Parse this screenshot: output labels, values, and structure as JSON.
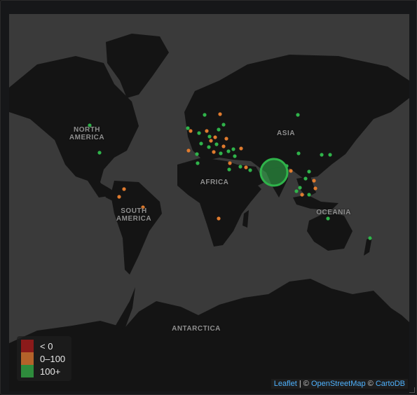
{
  "map": {
    "continent_labels": [
      {
        "id": "north-america",
        "text": "NORTH\nAMERICA"
      },
      {
        "id": "asia",
        "text": "ASIA"
      },
      {
        "id": "africa",
        "text": "AFRICA"
      },
      {
        "id": "south-america",
        "text": "SOUTH\nAMERICA"
      },
      {
        "id": "oceania",
        "text": "OCEANIA"
      },
      {
        "id": "antarctica",
        "text": "ANTARCTICA"
      }
    ],
    "highlight_marker": {
      "location": "India",
      "category": "100+"
    }
  },
  "legend": {
    "items": [
      {
        "label": "< 0",
        "color": "#8b1a1a"
      },
      {
        "label": "0–100",
        "color": "#b4622a"
      },
      {
        "label": "100+",
        "color": "#2e8b3c"
      }
    ]
  },
  "attribution": {
    "leaflet": "Leaflet",
    "sep1": " | © ",
    "osm": "OpenStreetMap",
    "sep2": " © ",
    "carto": "CartoDB"
  },
  "colors": {
    "ocean": "#3a3a3a",
    "land": "#141414",
    "marker_green": "#2fb34a",
    "marker_orange": "#e07b2e",
    "link": "#4fb3ff"
  }
}
